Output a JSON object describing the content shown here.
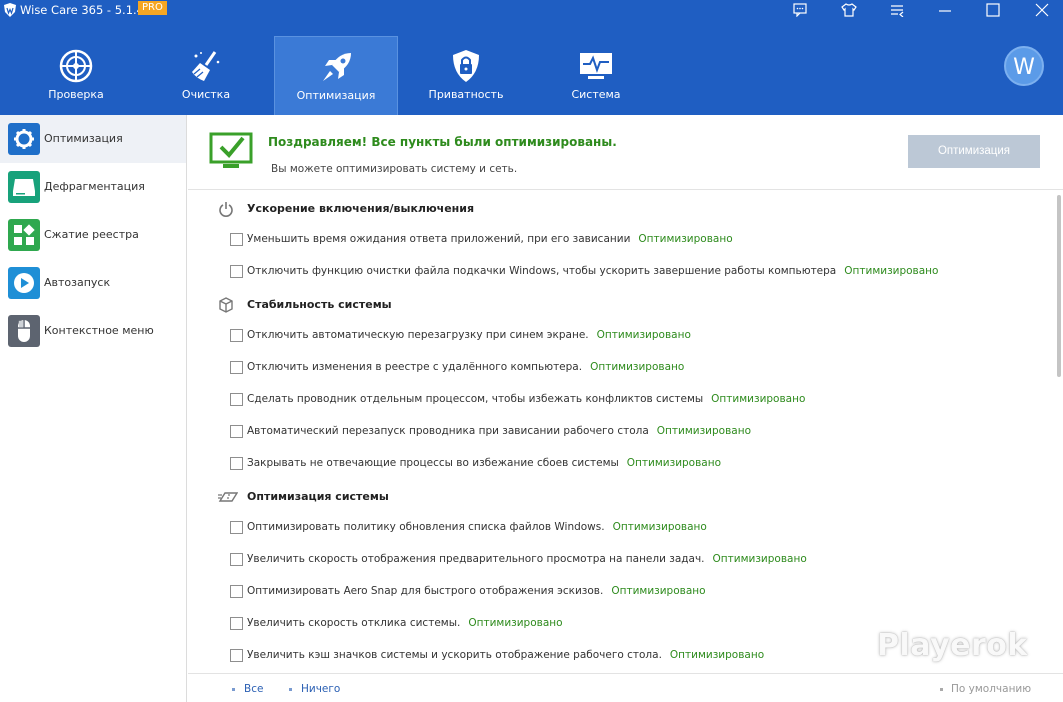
{
  "titlebar": {
    "title": "Wise Care 365 - 5.1.4",
    "badge": "PRO"
  },
  "colors": {
    "header": "#1f5ec2",
    "active_tab": "#3b7ad6",
    "success": "#2e8b1d",
    "badge": "#f5a623"
  },
  "nav": {
    "items": [
      {
        "label": "Проверка",
        "icon": "radar-icon"
      },
      {
        "label": "Очистка",
        "icon": "broom-icon"
      },
      {
        "label": "Оптимизация",
        "icon": "rocket-icon",
        "active": true
      },
      {
        "label": "Приватность",
        "icon": "lock-icon"
      },
      {
        "label": "Система",
        "icon": "monitor-icon"
      }
    ],
    "avatar": "W"
  },
  "sidebar": {
    "items": [
      {
        "label": "Оптимизация",
        "icon": "gear-icon",
        "active": true
      },
      {
        "label": "Дефрагментация",
        "icon": "disk-icon"
      },
      {
        "label": "Сжатие реестра",
        "icon": "registry-icon"
      },
      {
        "label": "Автозапуск",
        "icon": "play-icon"
      },
      {
        "label": "Контекстное меню",
        "icon": "mouse-icon"
      }
    ]
  },
  "banner": {
    "title": "Поздравляем! Все пункты были оптимизированы.",
    "subtitle": "Вы можете оптимизировать систему и сеть.",
    "button": "Оптимизация"
  },
  "status_text": "Оптимизировано",
  "sections": [
    {
      "title": "Ускорение включения/выключения",
      "icon": "power-icon",
      "items": [
        "Уменьшить время ожидания ответа приложений, при его зависании",
        "Отключить функцию очистки файла подкачки Windows, чтобы ускорить завершение работы компьютера"
      ]
    },
    {
      "title": "Стабильность системы",
      "icon": "cube-icon",
      "items": [
        "Отключить автоматическую перезагрузку при синем экране.",
        "Отключить изменения в реестре с удалённого компьютера.",
        "Сделать проводник отдельным процессом, чтобы избежать конфликтов системы",
        "Автоматический перезапуск проводника при зависании рабочего стола",
        "Закрывать не отвечающие процессы во избежание сбоев системы"
      ]
    },
    {
      "title": "Оптимизация системы",
      "icon": "speed-icon",
      "items": [
        "Оптимизировать политику обновления списка файлов Windows.",
        "Увеличить скорость отображения предварительного просмотра на панели задач.",
        "Оптимизировать Aero Snap для быстрого отображения эскизов.",
        "Увеличить скорость отклика системы.",
        "Увеличить кэш значков системы и ускорить отображение рабочего стола."
      ]
    }
  ],
  "footer": {
    "all": "Все",
    "none": "Ничего",
    "default": "По умолчанию"
  },
  "watermark": "Playerok"
}
